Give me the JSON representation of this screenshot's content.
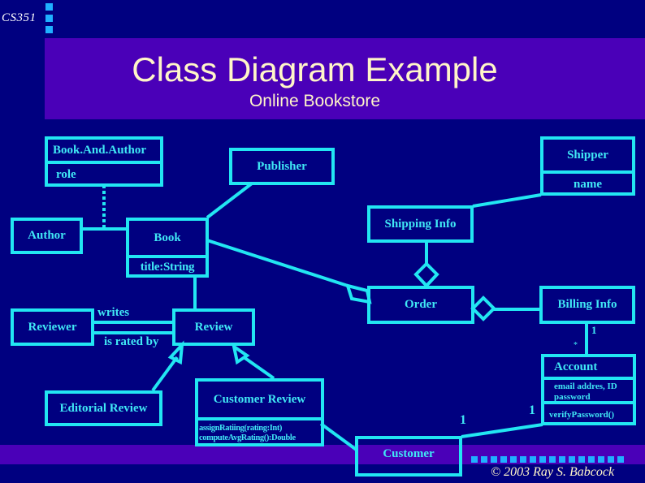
{
  "slide": {
    "course": "CS351",
    "title": "Class Diagram Example",
    "subtitle": "Online Bookstore",
    "footer": "© 2003  Ray S. Babcock"
  },
  "colors": {
    "background": "#000080",
    "band": "#4a00b8",
    "line": "#22e6f2",
    "text": "#40e8f5",
    "title_text": "#fff5c8",
    "bullet": "#1fb0ff"
  },
  "classes": {
    "book_and_author": {
      "name": "Book.And.Author",
      "attributes": "role"
    },
    "publisher": {
      "name": "Publisher"
    },
    "shipper": {
      "name": "Shipper",
      "attributes": "name"
    },
    "author": {
      "name": "Author"
    },
    "book": {
      "name": "Book",
      "attributes": "title:String"
    },
    "shipping_info": {
      "name": "Shipping Info"
    },
    "order": {
      "name": "Order"
    },
    "billing_info": {
      "name": "Billing Info"
    },
    "reviewer": {
      "name": "Reviewer"
    },
    "review": {
      "name": "Review"
    },
    "account": {
      "name": "Account",
      "attributes": [
        "email addres, ID",
        "password"
      ],
      "methods": "verifyPassword()"
    },
    "editorial_review": {
      "name": "Editorial Review"
    },
    "customer_review": {
      "name": "Customer Review",
      "methods": [
        "assignRatiing(rating:Int)",
        "computeAvgRating():Double"
      ]
    },
    "customer": {
      "name": "Customer"
    }
  },
  "associations": {
    "writes": "writes",
    "is_rated_by": "is rated by",
    "billing_account_one": "1",
    "billing_account_many": "*",
    "customer_one": "1",
    "account_one": "1"
  }
}
